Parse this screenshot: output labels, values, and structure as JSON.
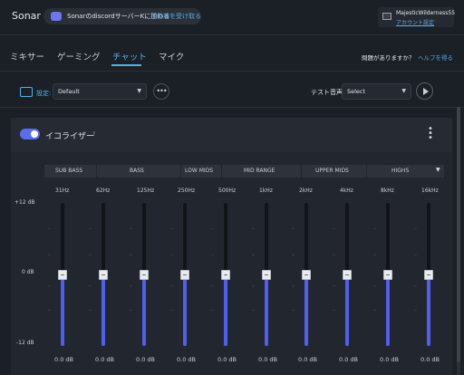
{
  "app": {
    "title": "Sonar"
  },
  "discord": {
    "text": "SonarのdiscordサーバーKに加わる",
    "link": "招待状を受け取る"
  },
  "account": {
    "name": "MajesticWilderness55",
    "link": "アカウント設定"
  },
  "tabs": [
    {
      "label": "ミキサー",
      "active": false
    },
    {
      "label": "ゲーミング",
      "active": false
    },
    {
      "label": "チャット",
      "active": true
    },
    {
      "label": "マイク",
      "active": false
    }
  ],
  "help": {
    "question": "問題がありますか？",
    "link": "ヘルプを得る"
  },
  "config": {
    "label": "設定:",
    "preset": "Default",
    "test_label": "テスト音声",
    "test_select": "Select"
  },
  "equalizer": {
    "title": "イコライザー",
    "help": "?",
    "enabled": true,
    "bands": [
      "SUB BASS",
      "BASS",
      "LOW MIDS",
      "MID RANGE",
      "UPPER MIDS",
      "HIGHS"
    ],
    "db_labels": {
      "top": "+12 dB",
      "mid": "0 dB",
      "bottom": "-12 dB"
    },
    "sliders": [
      {
        "freq": "31Hz",
        "gain": "0.0 dB",
        "value_db": 0
      },
      {
        "freq": "62Hz",
        "gain": "0.0 dB",
        "value_db": 0
      },
      {
        "freq": "125Hz",
        "gain": "0.0 dB",
        "value_db": 0
      },
      {
        "freq": "250Hz",
        "gain": "0.0 dB",
        "value_db": 0
      },
      {
        "freq": "500Hz",
        "gain": "0.0 dB",
        "value_db": 0
      },
      {
        "freq": "1kHz",
        "gain": "0.0 dB",
        "value_db": 0
      },
      {
        "freq": "2kHz",
        "gain": "0.0 dB",
        "value_db": 0
      },
      {
        "freq": "4kHz",
        "gain": "0.0 dB",
        "value_db": 0
      },
      {
        "freq": "8kHz",
        "gain": "0.0 dB",
        "value_db": 0
      },
      {
        "freq": "16kHz",
        "gain": "0.0 dB",
        "value_db": 0
      }
    ]
  },
  "colors": {
    "accent": "#4fb3ea",
    "slider_fill": "#4f5ff0",
    "background": "#1b1f26"
  }
}
